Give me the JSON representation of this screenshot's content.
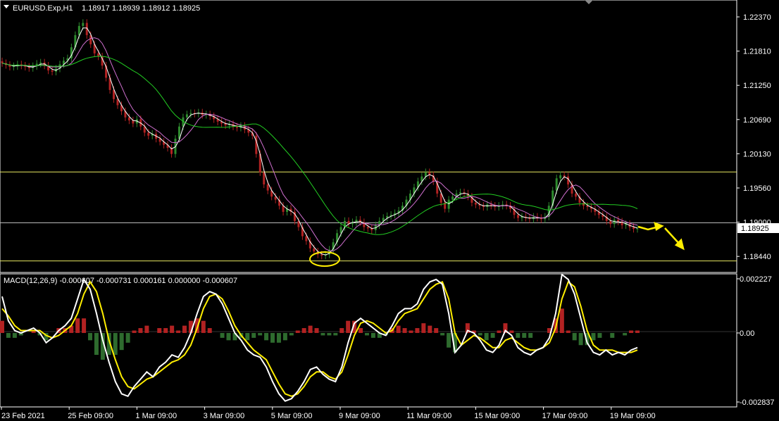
{
  "window": {
    "symbol_label": "EURUSD.Exp,H1",
    "ohlc": "1.18917 1.18939 1.18912 1.18925",
    "menu_icon": "triangle-down-icon"
  },
  "price_axis": {
    "ticks": [
      "1.22370",
      "1.21810",
      "1.21250",
      "1.20690",
      "1.20130",
      "1.19560",
      "1.19000",
      "1.18440"
    ],
    "current_price": "1.18925"
  },
  "macd": {
    "header": "MACD(12,26,9) -0.000607 -0.000731 0.000161 0.000000 -0.000607",
    "axis_ticks": [
      "0.002227",
      "0.00",
      "-0.002837"
    ]
  },
  "time_axis": {
    "labels": [
      "23 Feb 2021",
      "25 Feb 09:00",
      "1 Mar 09:00",
      "3 Mar 09:00",
      "5 Mar 09:00",
      "9 Mar 09:00",
      "11 Mar 09:00",
      "15 Mar 09:00",
      "17 Mar 09:00",
      "19 Mar 09:00"
    ]
  },
  "colors": {
    "background": "#000000",
    "bull": "#2e8b2e",
    "bear": "#b22222",
    "ma_white": "#ffffff",
    "ma_violet": "#d070d0",
    "ma_green": "#22cc22",
    "level_line": "#e8e860",
    "macd_main": "#ffffff",
    "macd_signal": "#ffee00",
    "macd_hist_pos": "#b22222",
    "macd_hist_neg": "#2e6b2e",
    "annotation": "#ffee00",
    "price_tag_bg": "#ffffff",
    "price_tag_text": "#000000"
  },
  "chart_data": {
    "type": "candlestick",
    "price_ylim": [
      1.1824,
      1.2263
    ],
    "levels": [
      1.19855,
      1.1902,
      1.18395
    ],
    "closes": [
      1.2164,
      1.2161,
      1.2158,
      1.2159,
      1.2162,
      1.216,
      1.2158,
      1.2156,
      1.2159,
      1.2163,
      1.2165,
      1.216,
      1.2152,
      1.215,
      1.2155,
      1.2162,
      1.2168,
      1.2172,
      1.219,
      1.221,
      1.2225,
      1.223,
      1.221,
      1.2195,
      1.218,
      1.2175,
      1.216,
      1.214,
      1.212,
      1.2105,
      1.2095,
      1.2085,
      1.2075,
      1.207,
      1.2065,
      1.2072,
      1.206,
      1.205,
      1.2045,
      1.2048,
      1.204,
      1.2035,
      1.203,
      1.2025,
      1.2015,
      1.204,
      1.206,
      1.2075,
      1.208,
      1.2082,
      1.2081,
      1.2083,
      1.2079,
      1.208,
      1.2077,
      1.2072,
      1.2068,
      1.2065,
      1.2062,
      1.2064,
      1.206,
      1.2058,
      1.2061,
      1.2055,
      1.205,
      1.2045,
      1.2015,
      1.1985,
      1.1965,
      1.1955,
      1.1945,
      1.194,
      1.193,
      1.192,
      1.1925,
      1.192,
      1.1905,
      1.1895,
      1.188,
      1.1872,
      1.186,
      1.1855,
      1.185,
      1.1848,
      1.185,
      1.1858,
      1.187,
      1.1885,
      1.1895,
      1.1905,
      1.19,
      1.1903,
      1.1907,
      1.1903,
      1.1895,
      1.1893,
      1.189,
      1.1898,
      1.1905,
      1.191,
      1.1913,
      1.1915,
      1.1918,
      1.1922,
      1.193,
      1.194,
      1.195,
      1.196,
      1.197,
      1.1978,
      1.1985,
      1.198,
      1.197,
      1.195,
      1.1935,
      1.1925,
      1.194,
      1.1945,
      1.195,
      1.1952,
      1.195,
      1.1945,
      1.1935,
      1.1932,
      1.193,
      1.1928,
      1.1932,
      1.193,
      1.1928,
      1.193,
      1.1932,
      1.193,
      1.1925,
      1.1915,
      1.191,
      1.1912,
      1.191,
      1.1908,
      1.1912,
      1.191,
      1.1908,
      1.1912,
      1.193,
      1.1955,
      1.1975,
      1.198,
      1.1978,
      1.1965,
      1.195,
      1.1945,
      1.1935,
      1.193,
      1.1928,
      1.1925,
      1.192,
      1.1915,
      1.1912,
      1.1905,
      1.19,
      1.1907,
      1.1904,
      1.1898,
      1.19,
      1.1895,
      1.1892,
      1.18925
    ],
    "macd_ylim": [
      -0.002837,
      0.002227
    ],
    "macd_main": [
      0.0015,
      0.0005,
      0.0001,
      0.0,
      0.0001,
      0.0002,
      0.0,
      -0.0004,
      -0.0002,
      0.0001,
      0.0003,
      0.0006,
      0.0014,
      0.0022,
      0.0018,
      0.0008,
      -0.0003,
      -0.0012,
      -0.002,
      -0.0025,
      -0.0026,
      -0.0022,
      -0.0019,
      -0.0016,
      -0.0018,
      -0.0014,
      -0.0012,
      -0.0009,
      -0.001,
      -0.0006,
      0.0,
      0.0008,
      0.0015,
      0.0017,
      0.0016,
      0.0012,
      0.0006,
      0.0,
      -0.0003,
      -0.0007,
      -0.0009,
      -0.001,
      -0.0014,
      -0.002,
      -0.0025,
      -0.0028,
      -0.0027,
      -0.0024,
      -0.002,
      -0.0015,
      -0.0014,
      -0.0017,
      -0.0019,
      -0.002,
      -0.0014,
      -0.0004,
      0.0004,
      0.0006,
      0.0004,
      0.0002,
      0.0,
      -0.0001,
      0.0003,
      0.0008,
      0.001,
      0.001,
      0.0012,
      0.0018,
      0.0021,
      0.0022,
      0.002,
      0.0008,
      -0.0008,
      -0.0005,
      0.0001,
      0.0,
      -0.0003,
      -0.0007,
      -0.0008,
      -0.0005,
      0.0001,
      -0.0001,
      -0.0006,
      -0.0008,
      -0.0009,
      -0.0007,
      -0.0006,
      -0.0002,
      0.0008,
      0.0024,
      0.0022,
      0.0016,
      0.0006,
      -0.0004,
      -0.0008,
      -0.0009,
      -0.0007,
      -0.0009,
      -0.0008,
      -0.0009,
      -0.0007,
      -0.0006
    ],
    "macd_signal": [
      0.001,
      0.0007,
      0.0003,
      0.0001,
      0.0001,
      0.0001,
      0.0001,
      -0.0001,
      -0.0002,
      -0.0001,
      0.0001,
      0.0003,
      0.0008,
      0.0016,
      0.0021,
      0.0017,
      0.0008,
      -0.0003,
      -0.0011,
      -0.0018,
      -0.0022,
      -0.0023,
      -0.0021,
      -0.0019,
      -0.0018,
      -0.0016,
      -0.0014,
      -0.0012,
      -0.0011,
      -0.0009,
      -0.0005,
      0.0002,
      0.001,
      0.0015,
      0.0016,
      0.0014,
      0.0009,
      0.0003,
      -0.0001,
      -0.0004,
      -0.0007,
      -0.0009,
      -0.0011,
      -0.0016,
      -0.0021,
      -0.0025,
      -0.0026,
      -0.0025,
      -0.0022,
      -0.0018,
      -0.0016,
      -0.0016,
      -0.0018,
      -0.0019,
      -0.0016,
      -0.0009,
      -0.0001,
      0.0004,
      0.0005,
      0.0004,
      0.0002,
      0.0,
      0.0001,
      0.0005,
      0.0008,
      0.0009,
      0.001,
      0.0014,
      0.0018,
      0.002,
      0.0021,
      0.0014,
      0.0,
      -0.0005,
      -0.0003,
      -0.0001,
      -0.0002,
      -0.0004,
      -0.0006,
      -0.0006,
      -0.0003,
      -0.0002,
      -0.0004,
      -0.0006,
      -0.0007,
      -0.0007,
      -0.0006,
      -0.0004,
      0.0002,
      0.0014,
      0.0021,
      0.0019,
      0.0011,
      0.0001,
      -0.0005,
      -0.0007,
      -0.0007,
      -0.0007,
      -0.0008,
      -0.0008,
      -0.0008,
      -0.0007
    ],
    "macd_hist": [
      0.0005,
      -0.0002,
      -0.0002,
      -0.0001,
      0.0,
      0.0001,
      -0.0001,
      -0.0003,
      0.0,
      0.0002,
      0.0002,
      0.0003,
      0.0006,
      0.0006,
      -0.0003,
      -0.0009,
      -0.0011,
      -0.0009,
      -0.0009,
      -0.0007,
      -0.0004,
      0.0001,
      0.0002,
      0.0003,
      0.0,
      0.0002,
      0.0002,
      0.0003,
      0.0001,
      0.0003,
      0.0005,
      0.0006,
      0.0005,
      0.0002,
      0.0,
      -0.0002,
      -0.0003,
      -0.0003,
      -0.0002,
      -0.0003,
      -0.0002,
      -0.0001,
      -0.0003,
      -0.0004,
      -0.0004,
      -0.0003,
      -0.0001,
      0.0001,
      0.0002,
      0.0003,
      0.0002,
      -0.0001,
      -0.0001,
      -0.0001,
      0.0002,
      0.0005,
      0.0005,
      0.0002,
      -0.0001,
      -0.0002,
      -0.0002,
      -0.0001,
      0.0002,
      0.0003,
      0.0002,
      0.0001,
      0.0002,
      0.0004,
      0.0003,
      0.0002,
      -0.0001,
      -0.0006,
      -0.0008,
      0.0,
      0.0004,
      0.0001,
      -0.0001,
      -0.0003,
      -0.0002,
      0.0001,
      0.0004,
      0.0001,
      -0.0002,
      -0.0002,
      -0.0002,
      0.0,
      0.0,
      0.0002,
      0.0006,
      0.001,
      0.0001,
      -0.0003,
      -0.0005,
      -0.0005,
      -0.0003,
      -0.0002,
      0.0,
      -0.0002,
      0.0,
      -0.0001,
      0.0001,
      0.0001
    ]
  }
}
